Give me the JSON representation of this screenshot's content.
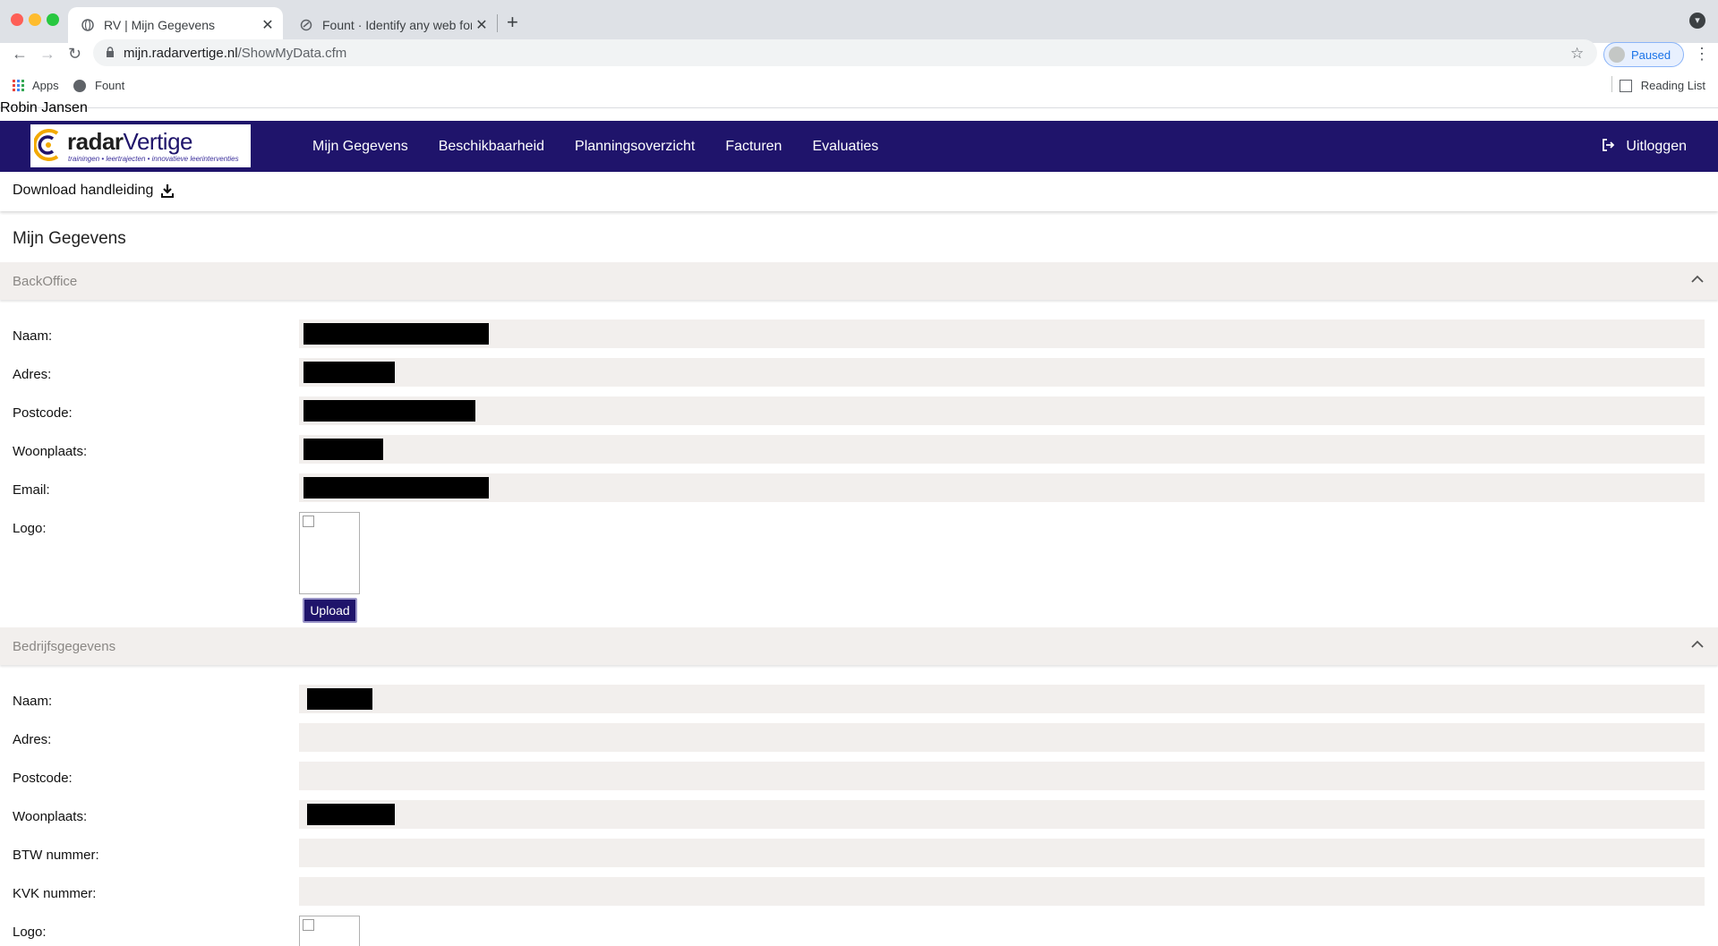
{
  "browser": {
    "tabs": [
      {
        "title": "RV | Mijn Gegevens",
        "active": true
      },
      {
        "title": "Fount · Identify any web font yo",
        "active": false
      }
    ],
    "url_host": "mijn.radarvertige.nl",
    "url_path": "/ShowMyData.cfm",
    "profile_label": "Paused",
    "bookmarks": [
      "Apps",
      "Fount"
    ],
    "reading_list": "Reading List"
  },
  "user": {
    "name": "Robin Jansen"
  },
  "brand": {
    "name_main": "radar",
    "name_accent": "Vertige",
    "tagline": "trainingen • leertrajecten • innovatieve leerinterventies",
    "nav_color": "#1f146b"
  },
  "nav": {
    "items": [
      "Mijn Gegevens",
      "Beschikbaarheid",
      "Planningsoverzicht",
      "Facturen",
      "Evaluaties"
    ],
    "logout": "Uitloggen"
  },
  "download_label": "Download handleiding",
  "page_title": "Mijn Gegevens",
  "backoffice": {
    "title": "BackOffice",
    "labels": {
      "naam": "Naam:",
      "adres": "Adres:",
      "postcode": "Postcode:",
      "woonplaats": "Woonplaats:",
      "email": "Email:",
      "logo": "Logo:"
    },
    "upload_label": "Upload"
  },
  "bedrijf": {
    "title": "Bedrijfsgegevens",
    "labels": {
      "naam": "Naam:",
      "adres": "Adres:",
      "postcode": "Postcode:",
      "woonplaats": "Woonplaats:",
      "btw": "BTW nummer:",
      "kvk": "KVK nummer:",
      "logo": "Logo:"
    }
  }
}
